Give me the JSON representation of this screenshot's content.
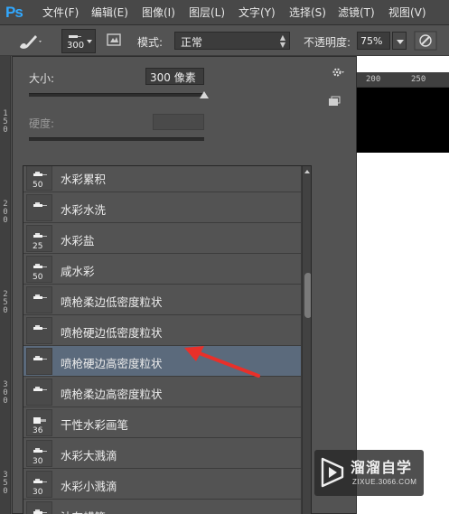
{
  "app": {
    "logo_text": "Ps"
  },
  "menu": [
    "文件(F)",
    "编辑(E)",
    "图像(I)",
    "图层(L)",
    "文字(Y)",
    "选择(S)",
    "滤镜(T)",
    "视图(V)"
  ],
  "options": {
    "brush_size": "300",
    "mode_label": "模式:",
    "mode_value": "正常",
    "opacity_label": "不透明度:",
    "opacity_value": "75%"
  },
  "ruler": {
    "top_ticks": [
      "200",
      "250"
    ],
    "left_ticks": [
      "1",
      "5",
      "0",
      "2",
      "0",
      "0",
      "2",
      "5",
      "0",
      "3",
      "0",
      "0",
      "3",
      "5",
      "0"
    ]
  },
  "picker": {
    "size_label": "大小:",
    "size_value": "300 像素",
    "size_slider_percent": 100,
    "hardness_label": "硬度:",
    "hardness_value": ""
  },
  "brushes": [
    {
      "name": "水彩累积",
      "size": "50",
      "glyph": "dab"
    },
    {
      "name": "水彩水洗",
      "size": "",
      "glyph": "dab"
    },
    {
      "name": "水彩盐",
      "size": "25",
      "glyph": "dab"
    },
    {
      "name": "咸水彩",
      "size": "50",
      "glyph": "dab"
    },
    {
      "name": "喷枪柔边低密度粒状",
      "size": "",
      "glyph": "dab"
    },
    {
      "name": "喷枪硬边低密度粒状",
      "size": "",
      "glyph": "dab"
    },
    {
      "name": "喷枪硬边高密度粒状",
      "size": "",
      "glyph": "dab",
      "selected": true
    },
    {
      "name": "喷枪柔边高密度粒状",
      "size": "",
      "glyph": "dab"
    },
    {
      "name": "干性水彩画笔",
      "size": "36",
      "glyph": "block"
    },
    {
      "name": "水彩大溅滴",
      "size": "30",
      "glyph": "dab"
    },
    {
      "name": "水彩小溅滴",
      "size": "30",
      "glyph": "dab"
    },
    {
      "name": "油布蜡笔",
      "size": "",
      "glyph": "dab"
    }
  ],
  "watermark": {
    "title": "溜溜自学",
    "subtitle": "ZIXUE.3066.COM"
  },
  "colors": {
    "selection": "#5b6a7c",
    "annotation_arrow": "#e8302a",
    "ps_blue": "#31a8ff"
  }
}
